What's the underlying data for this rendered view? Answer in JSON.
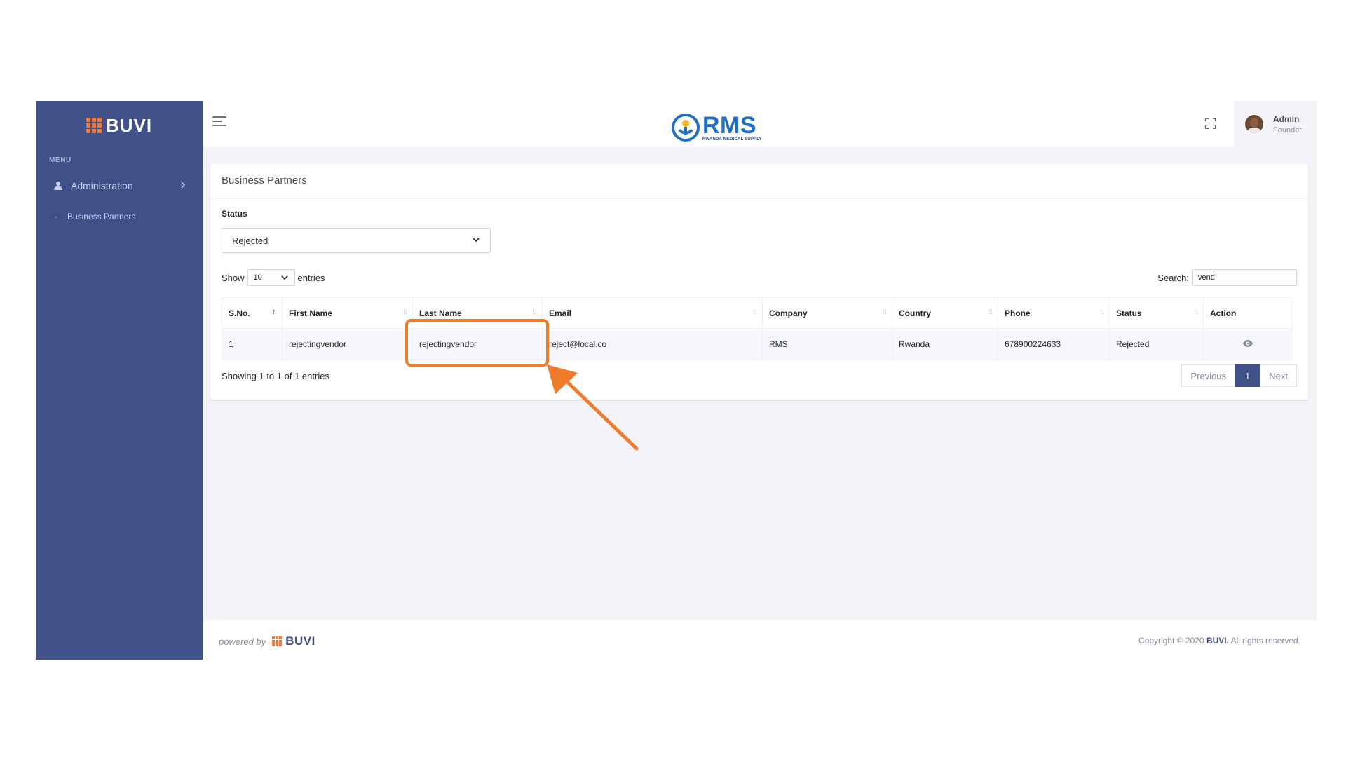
{
  "sidebar": {
    "brand": "BUVI",
    "menu_title": "MENU",
    "items": [
      {
        "label": "Administration",
        "icon": "user-icon"
      }
    ],
    "sub_items": [
      {
        "label": "Business Partners"
      }
    ]
  },
  "topbar": {
    "logo_text": "RMS",
    "logo_subtitle": "RWANDA MEDICAL SUPPLY",
    "user": {
      "name": "Admin",
      "role": "Founder"
    }
  },
  "card": {
    "title": "Business Partners",
    "status_label": "Status",
    "status_value": "Rejected",
    "show_prefix": "Show",
    "show_value": "10",
    "show_suffix": "entries",
    "search_label": "Search:",
    "search_value": "vend",
    "columns": [
      "S.No.",
      "First Name",
      "Last Name",
      "Email",
      "Company",
      "Country",
      "Phone",
      "Status",
      "Action"
    ],
    "rows": [
      {
        "sno": "1",
        "first_name": "rejectingvendor",
        "last_name": "rejectingvendor",
        "email": "reject@local.co",
        "company": "RMS",
        "country": "Rwanda",
        "phone": "678900224633",
        "status": "Rejected"
      }
    ],
    "info": "Showing 1 to 1 of 1 entries",
    "pagination": {
      "previous": "Previous",
      "current": "1",
      "next": "Next"
    }
  },
  "footer": {
    "powered_by": "powered by",
    "brand": "BUVI",
    "copyright_prefix": "Copyright © 2020",
    "copyright_brand": "BUVI.",
    "copyright_suffix": "All rights reserved."
  },
  "colors": {
    "sidebar": "#405189",
    "accent_orange": "#f07b2b",
    "page_bg": "#f3f3f9"
  }
}
